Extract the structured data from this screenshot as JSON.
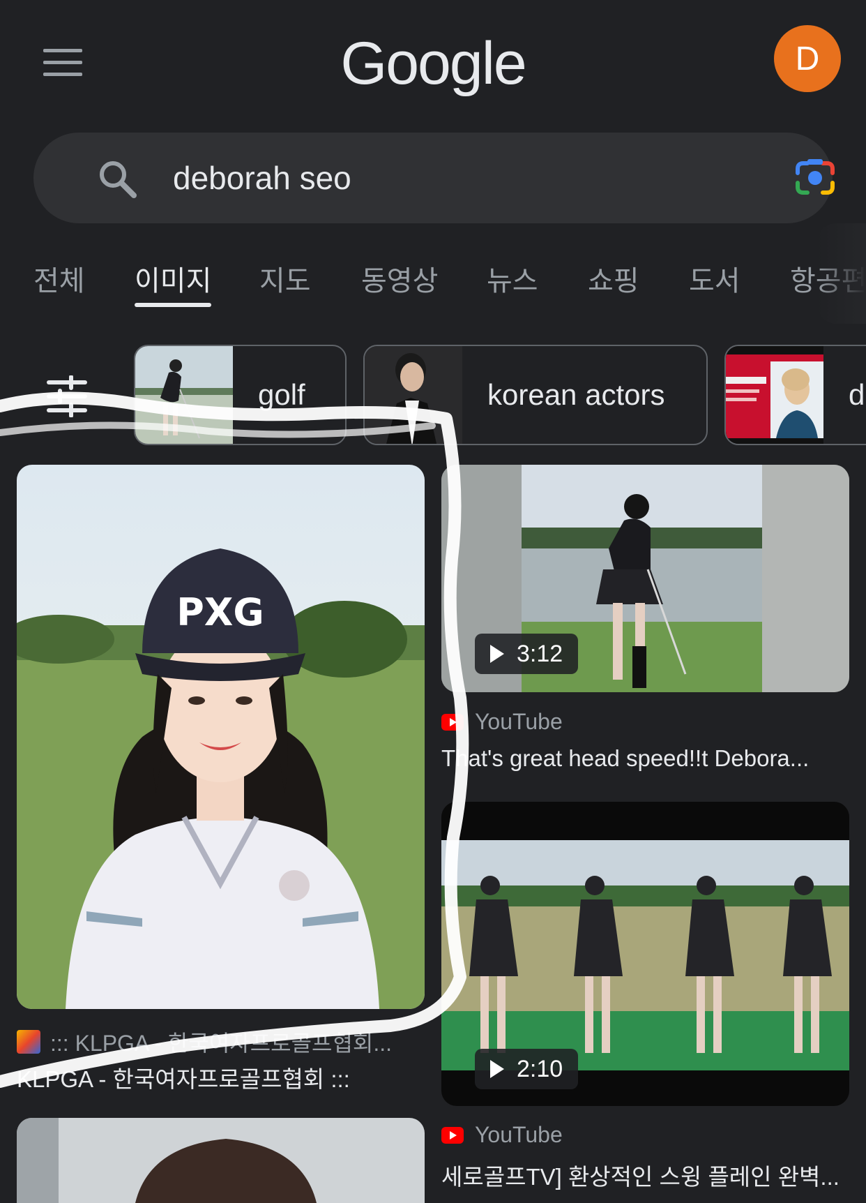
{
  "header": {
    "logo": "Google",
    "avatar_letter": "D"
  },
  "search": {
    "query": "deborah seo"
  },
  "tabs": [
    {
      "label": "전체"
    },
    {
      "label": "이미지"
    },
    {
      "label": "지도"
    },
    {
      "label": "동영상"
    },
    {
      "label": "뉴스"
    },
    {
      "label": "쇼핑"
    },
    {
      "label": "도서"
    },
    {
      "label": "항공편"
    }
  ],
  "active_tab": "이미지",
  "chips": [
    {
      "label": "golf"
    },
    {
      "label": "korean actors"
    },
    {
      "label": "d"
    }
  ],
  "results": [
    {
      "source": "::: KLPGA - 한국여자프로골프협회...",
      "title": "KLPGA - 한국여자프로골프협회 :::"
    },
    {
      "duration": "3:12",
      "source": "YouTube",
      "title": "That's great head speed!!t Debora..."
    },
    {
      "duration": "2:10",
      "source": "YouTube",
      "title": "세로골프TV] 환상적인 스윙 플레인 완벽..."
    }
  ],
  "colors": {
    "background": "#202124",
    "avatar": "#e8711d",
    "search_bar": "#303134",
    "youtube": "#ff0000"
  },
  "icons": [
    "hamburger-menu-icon",
    "search-icon",
    "google-lens-icon",
    "filter-sliders-icon",
    "youtube-icon",
    "klpga-favicon-icon",
    "play-icon"
  ]
}
